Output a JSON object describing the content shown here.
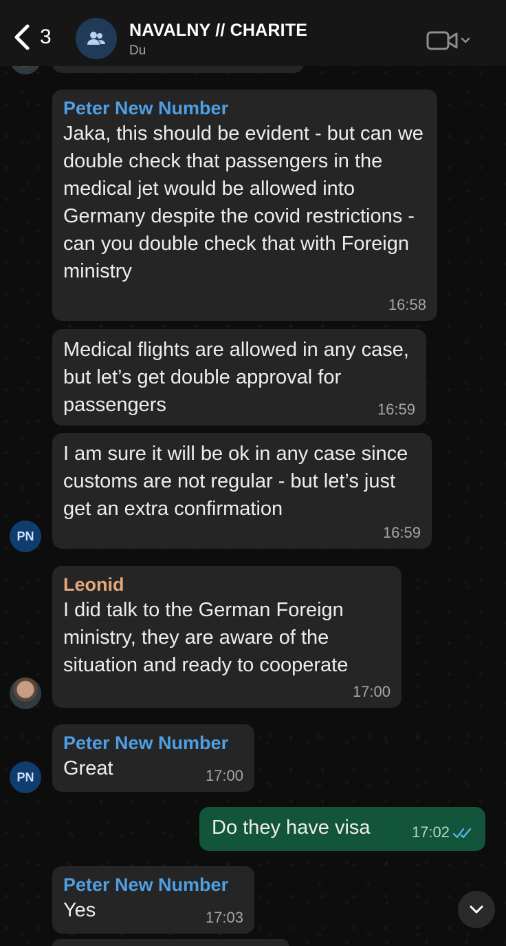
{
  "header": {
    "back_count": "3",
    "title": "NAVALNY // CHARITE",
    "subtitle": "Du",
    "icons": {
      "back": "chevron-left-icon",
      "group": "group-icon",
      "video": "video-call-icon"
    }
  },
  "messages": [
    {
      "sender": "Peter New Number",
      "text": "Jaka, this should be evident - but can we double check that passengers in the medical jet would be allowed into Germany despite the covid restrictions - can you double check that with Foreign ministry",
      "time": "16:58"
    },
    {
      "text": "Medical flights are allowed in any case, but let’s get double approval for passengers",
      "time": "16:59"
    },
    {
      "text": "I am sure it will be ok in any case since customs are not regular - but let’s just get an extra confirmation",
      "time": "16:59",
      "avatar": "PN"
    },
    {
      "sender": "Leonid",
      "text": "I did talk to the German Foreign ministry, they are aware of the situation and ready to cooperate",
      "time": "17:00"
    },
    {
      "sender": "Peter New Number",
      "text": "Great",
      "time": "17:00",
      "avatar": "PN"
    },
    {
      "text": "Do they have visa",
      "time": "17:02",
      "direction": "outgoing",
      "status": "read"
    },
    {
      "sender": "Peter New Number",
      "text": "Yes",
      "time": "17:03"
    }
  ],
  "colors": {
    "background": "#0d0d0e",
    "incoming_bubble": "#252526",
    "outgoing_bubble": "#12553a",
    "sender_peter": "#4e9fe4",
    "sender_leonid": "#e6a87a",
    "read_ticks": "#5bb8f0"
  }
}
